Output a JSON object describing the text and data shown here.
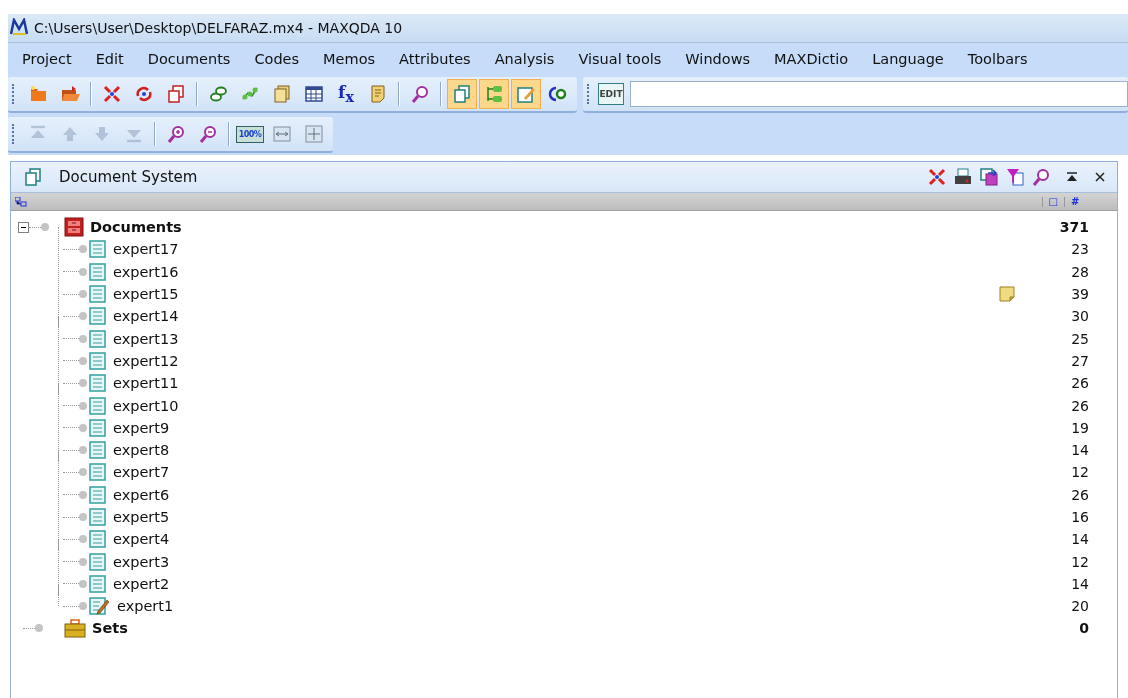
{
  "window": {
    "title": "C:\\Users\\User\\Desktop\\DELFARAZ.mx4 - MAXQDA 10"
  },
  "menu": [
    "Project",
    "Edit",
    "Documents",
    "Codes",
    "Memos",
    "Attributes",
    "Analysis",
    "Visual tools",
    "Windows",
    "MAXDictio",
    "Language",
    "Toolbars"
  ],
  "toolbar_1": {
    "buttons": [
      {
        "on": false
      },
      {
        "on": false
      },
      {
        "on": false
      },
      {
        "on": false
      },
      {
        "on": false
      },
      {
        "on": false
      },
      {
        "on": false
      },
      {
        "on": false
      },
      {
        "on": false
      },
      {
        "on": false,
        "label": "f$_{x}$"
      },
      {
        "on": false
      },
      {
        "on": false
      },
      {
        "on": true
      },
      {
        "on": true
      },
      {
        "on": true
      },
      {
        "on": false
      }
    ],
    "edit_label": "EDIT"
  },
  "toolbar_2": {
    "buttons": [
      {
        "disabled": true
      },
      {
        "disabled": true
      },
      {
        "disabled": true
      },
      {
        "disabled": true
      },
      {
        "disabled": false
      },
      {
        "disabled": false
      },
      {
        "disabled": false,
        "label": "100%"
      },
      {
        "disabled": false
      },
      {
        "disabled": false
      }
    ]
  },
  "panel": {
    "title": "Document System",
    "columns": [
      "□",
      "#"
    ],
    "tree": [
      {
        "kind": "documents",
        "label": "Documents",
        "count": "371",
        "expanded": true,
        "children": [
          {
            "label": "expert17",
            "count": "23",
            "memo": false,
            "edited": false
          },
          {
            "label": "expert16",
            "count": "28",
            "memo": false,
            "edited": false
          },
          {
            "label": "expert15",
            "count": "39",
            "memo": true,
            "edited": false
          },
          {
            "label": "expert14",
            "count": "30",
            "memo": false,
            "edited": false
          },
          {
            "label": "expert13",
            "count": "25",
            "memo": false,
            "edited": false
          },
          {
            "label": "expert12",
            "count": "27",
            "memo": false,
            "edited": false
          },
          {
            "label": "expert11",
            "count": "26",
            "memo": false,
            "edited": false
          },
          {
            "label": "expert10",
            "count": "26",
            "memo": false,
            "edited": false
          },
          {
            "label": "expert9",
            "count": "19",
            "memo": false,
            "edited": false
          },
          {
            "label": "expert8",
            "count": "14",
            "memo": false,
            "edited": false
          },
          {
            "label": "expert7",
            "count": "12",
            "memo": false,
            "edited": false
          },
          {
            "label": "expert6",
            "count": "26",
            "memo": false,
            "edited": false
          },
          {
            "label": "expert5",
            "count": "16",
            "memo": false,
            "edited": false
          },
          {
            "label": "expert4",
            "count": "14",
            "memo": false,
            "edited": false
          },
          {
            "label": "expert3",
            "count": "12",
            "memo": false,
            "edited": false
          },
          {
            "label": "expert2",
            "count": "14",
            "memo": false,
            "edited": false
          },
          {
            "label": "expert1",
            "count": "20",
            "memo": false,
            "edited": true
          }
        ]
      },
      {
        "kind": "sets",
        "label": "Sets",
        "count": "0"
      }
    ]
  }
}
